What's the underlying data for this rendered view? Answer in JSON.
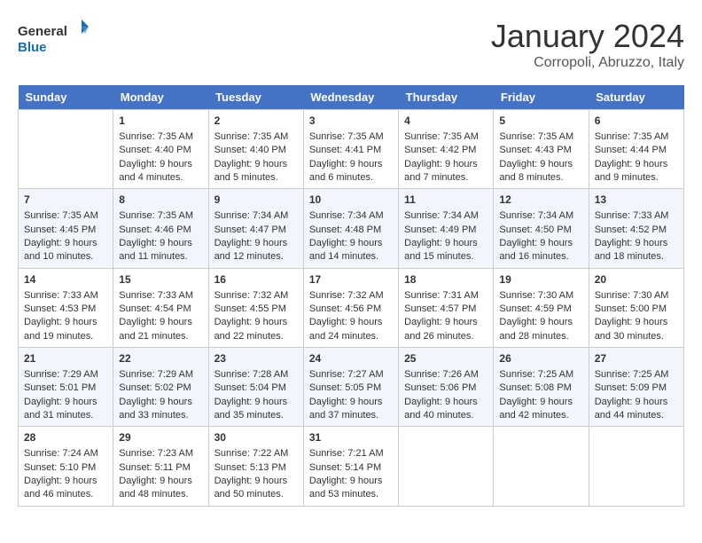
{
  "header": {
    "logo": {
      "general": "General",
      "blue": "Blue"
    },
    "title": "January 2024",
    "location": "Corropoli, Abruzzo, Italy"
  },
  "weekdays": [
    "Sunday",
    "Monday",
    "Tuesday",
    "Wednesday",
    "Thursday",
    "Friday",
    "Saturday"
  ],
  "weeks": [
    [
      {
        "day": "",
        "info": ""
      },
      {
        "day": "1",
        "info": "Sunrise: 7:35 AM\nSunset: 4:40 PM\nDaylight: 9 hours\nand 4 minutes."
      },
      {
        "day": "2",
        "info": "Sunrise: 7:35 AM\nSunset: 4:40 PM\nDaylight: 9 hours\nand 5 minutes."
      },
      {
        "day": "3",
        "info": "Sunrise: 7:35 AM\nSunset: 4:41 PM\nDaylight: 9 hours\nand 6 minutes."
      },
      {
        "day": "4",
        "info": "Sunrise: 7:35 AM\nSunset: 4:42 PM\nDaylight: 9 hours\nand 7 minutes."
      },
      {
        "day": "5",
        "info": "Sunrise: 7:35 AM\nSunset: 4:43 PM\nDaylight: 9 hours\nand 8 minutes."
      },
      {
        "day": "6",
        "info": "Sunrise: 7:35 AM\nSunset: 4:44 PM\nDaylight: 9 hours\nand 9 minutes."
      }
    ],
    [
      {
        "day": "7",
        "info": "Sunrise: 7:35 AM\nSunset: 4:45 PM\nDaylight: 9 hours\nand 10 minutes."
      },
      {
        "day": "8",
        "info": "Sunrise: 7:35 AM\nSunset: 4:46 PM\nDaylight: 9 hours\nand 11 minutes."
      },
      {
        "day": "9",
        "info": "Sunrise: 7:34 AM\nSunset: 4:47 PM\nDaylight: 9 hours\nand 12 minutes."
      },
      {
        "day": "10",
        "info": "Sunrise: 7:34 AM\nSunset: 4:48 PM\nDaylight: 9 hours\nand 14 minutes."
      },
      {
        "day": "11",
        "info": "Sunrise: 7:34 AM\nSunset: 4:49 PM\nDaylight: 9 hours\nand 15 minutes."
      },
      {
        "day": "12",
        "info": "Sunrise: 7:34 AM\nSunset: 4:50 PM\nDaylight: 9 hours\nand 16 minutes."
      },
      {
        "day": "13",
        "info": "Sunrise: 7:33 AM\nSunset: 4:52 PM\nDaylight: 9 hours\nand 18 minutes."
      }
    ],
    [
      {
        "day": "14",
        "info": "Sunrise: 7:33 AM\nSunset: 4:53 PM\nDaylight: 9 hours\nand 19 minutes."
      },
      {
        "day": "15",
        "info": "Sunrise: 7:33 AM\nSunset: 4:54 PM\nDaylight: 9 hours\nand 21 minutes."
      },
      {
        "day": "16",
        "info": "Sunrise: 7:32 AM\nSunset: 4:55 PM\nDaylight: 9 hours\nand 22 minutes."
      },
      {
        "day": "17",
        "info": "Sunrise: 7:32 AM\nSunset: 4:56 PM\nDaylight: 9 hours\nand 24 minutes."
      },
      {
        "day": "18",
        "info": "Sunrise: 7:31 AM\nSunset: 4:57 PM\nDaylight: 9 hours\nand 26 minutes."
      },
      {
        "day": "19",
        "info": "Sunrise: 7:30 AM\nSunset: 4:59 PM\nDaylight: 9 hours\nand 28 minutes."
      },
      {
        "day": "20",
        "info": "Sunrise: 7:30 AM\nSunset: 5:00 PM\nDaylight: 9 hours\nand 30 minutes."
      }
    ],
    [
      {
        "day": "21",
        "info": "Sunrise: 7:29 AM\nSunset: 5:01 PM\nDaylight: 9 hours\nand 31 minutes."
      },
      {
        "day": "22",
        "info": "Sunrise: 7:29 AM\nSunset: 5:02 PM\nDaylight: 9 hours\nand 33 minutes."
      },
      {
        "day": "23",
        "info": "Sunrise: 7:28 AM\nSunset: 5:04 PM\nDaylight: 9 hours\nand 35 minutes."
      },
      {
        "day": "24",
        "info": "Sunrise: 7:27 AM\nSunset: 5:05 PM\nDaylight: 9 hours\nand 37 minutes."
      },
      {
        "day": "25",
        "info": "Sunrise: 7:26 AM\nSunset: 5:06 PM\nDaylight: 9 hours\nand 40 minutes."
      },
      {
        "day": "26",
        "info": "Sunrise: 7:25 AM\nSunset: 5:08 PM\nDaylight: 9 hours\nand 42 minutes."
      },
      {
        "day": "27",
        "info": "Sunrise: 7:25 AM\nSunset: 5:09 PM\nDaylight: 9 hours\nand 44 minutes."
      }
    ],
    [
      {
        "day": "28",
        "info": "Sunrise: 7:24 AM\nSunset: 5:10 PM\nDaylight: 9 hours\nand 46 minutes."
      },
      {
        "day": "29",
        "info": "Sunrise: 7:23 AM\nSunset: 5:11 PM\nDaylight: 9 hours\nand 48 minutes."
      },
      {
        "day": "30",
        "info": "Sunrise: 7:22 AM\nSunset: 5:13 PM\nDaylight: 9 hours\nand 50 minutes."
      },
      {
        "day": "31",
        "info": "Sunrise: 7:21 AM\nSunset: 5:14 PM\nDaylight: 9 hours\nand 53 minutes."
      },
      {
        "day": "",
        "info": ""
      },
      {
        "day": "",
        "info": ""
      },
      {
        "day": "",
        "info": ""
      }
    ]
  ]
}
